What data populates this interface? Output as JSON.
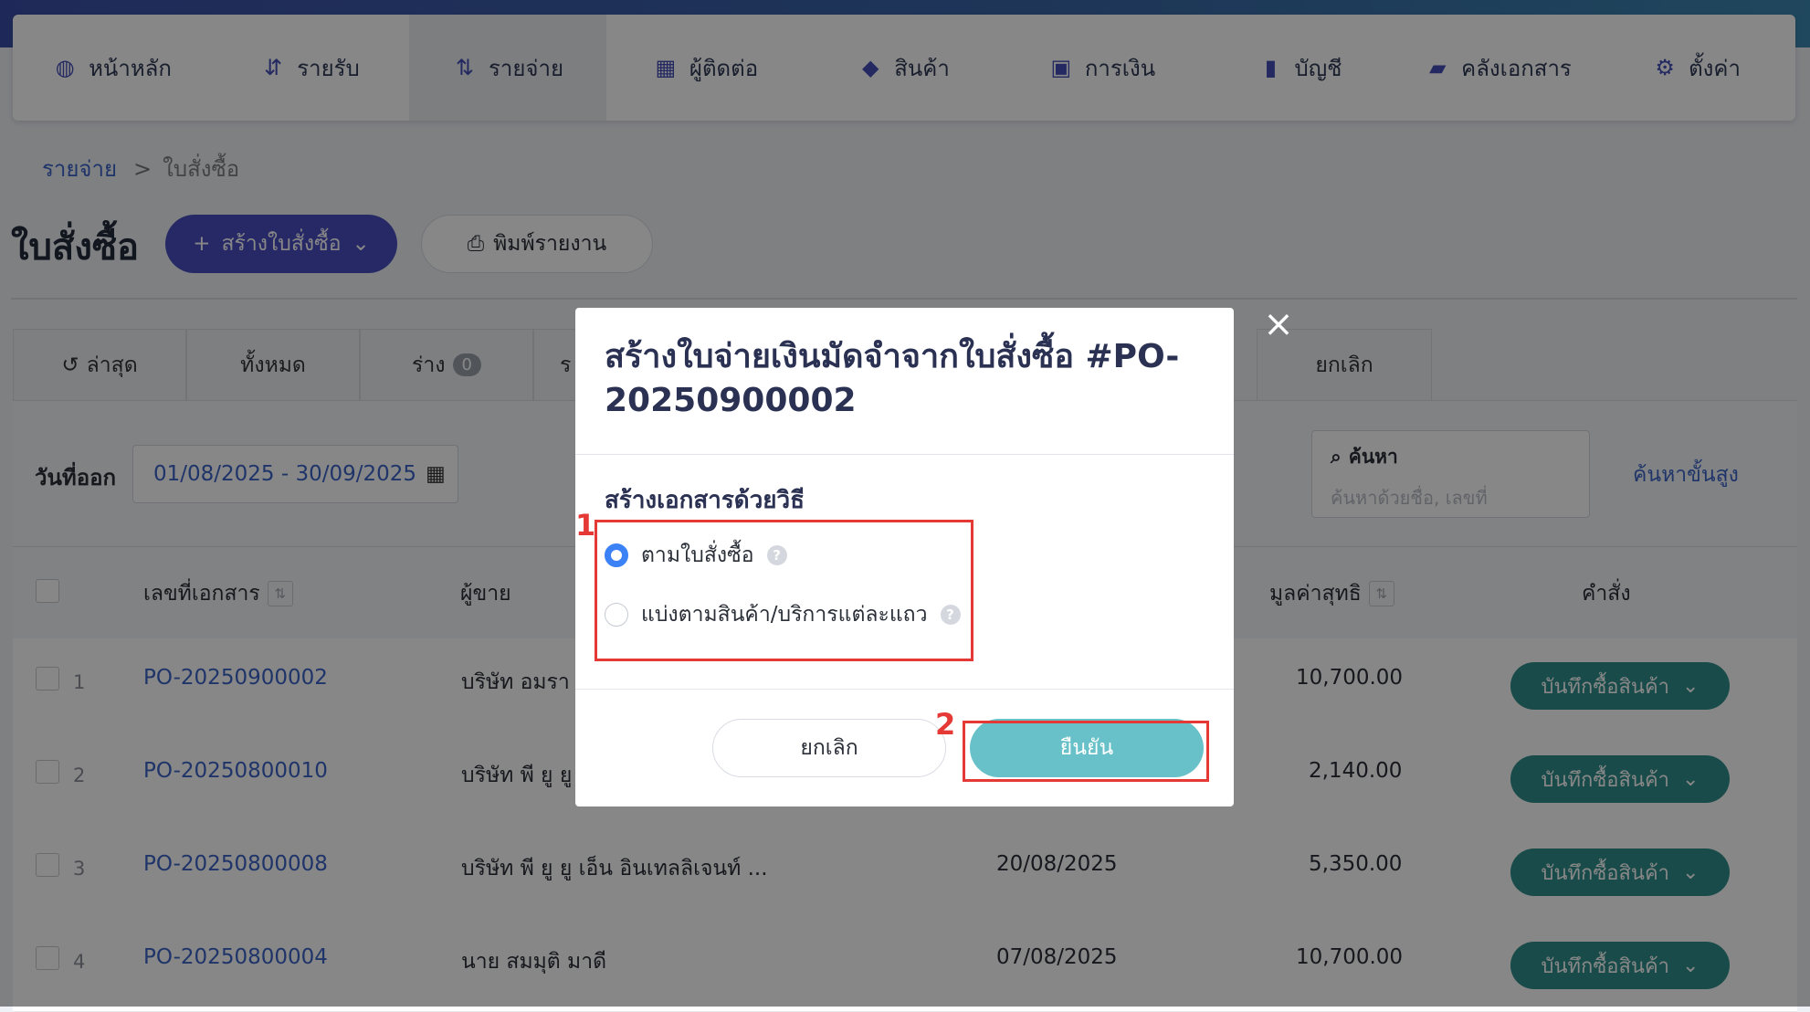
{
  "nav": {
    "items": [
      {
        "label": "หน้าหลัก",
        "icon": "dashboard-icon"
      },
      {
        "label": "รายรับ",
        "icon": "income-list-icon"
      },
      {
        "label": "รายจ่าย",
        "icon": "expense-list-icon",
        "active": true
      },
      {
        "label": "ผู้ติดต่อ",
        "icon": "contacts-icon"
      },
      {
        "label": "สินค้า",
        "icon": "product-box-icon"
      },
      {
        "label": "การเงิน",
        "icon": "money-icon"
      },
      {
        "label": "บัญชี",
        "icon": "ledger-icon"
      },
      {
        "label": "คลังเอกสาร",
        "icon": "folder-icon"
      },
      {
        "label": "ตั้งค่า",
        "icon": "gear-icon"
      }
    ]
  },
  "breadcrumb": {
    "parent": "รายจ่าย",
    "separator": ">",
    "current": "ใบสั่งซื้อ"
  },
  "page": {
    "title": "ใบสั่งซื้อ",
    "create_label": "สร้างใบสั่งซื้อ",
    "print_label": "พิมพ์รายงาน"
  },
  "tabs": {
    "latest": "ล่าสุด",
    "all": "ทั้งหมด",
    "draft": "ร่าง",
    "draft_count": "0",
    "partial": "ร",
    "cancelled": "ยกเลิก"
  },
  "filter": {
    "date_label": "วันที่ออก",
    "date_range": "01/08/2025 - 30/09/2025",
    "search_label": "ค้นหา",
    "search_placeholder": "ค้นหาด้วยชื่อ, เลขที่",
    "advanced_search": "ค้นหาขั้นสูง"
  },
  "table": {
    "headers": {
      "doc_no": "เลขที่เอกสาร",
      "vendor": "ผู้ขาย",
      "net": "มูลค่าสุทธิ",
      "actions": "คำสั่ง"
    },
    "rows": [
      {
        "num": "1",
        "doc_no": "PO-20250900002",
        "vendor": "บริษัท อมรา",
        "date": "",
        "net": "10,700.00",
        "action": "บันทึกซื้อสินค้า"
      },
      {
        "num": "2",
        "doc_no": "PO-20250800010",
        "vendor": "บริษัท พี ยู ยู",
        "date": "",
        "net": "2,140.00",
        "action": "บันทึกซื้อสินค้า"
      },
      {
        "num": "3",
        "doc_no": "PO-20250800008",
        "vendor": "บริษัท พี ยู ยู เอ็น อินเทลลิเจนท์ ...",
        "date": "20/08/2025",
        "net": "5,350.00",
        "action": "บันทึกซื้อสินค้า"
      },
      {
        "num": "4",
        "doc_no": "PO-20250800004",
        "vendor": "นาย สมมุติ มาดี",
        "date": "07/08/2025",
        "net": "10,700.00",
        "action": "บันทึกซื้อสินค้า"
      }
    ]
  },
  "modal": {
    "title": "สร้างใบจ่ายเงินมัดจำจากใบสั่งซื้อ #PO-20250900002",
    "method_label": "สร้างเอกสารด้วยวิธี",
    "options": [
      {
        "label": "ตามใบสั่งซื้อ",
        "selected": true
      },
      {
        "label": "แบ่งตามสินค้า/บริการแต่ละแถว",
        "selected": false
      }
    ],
    "cancel_label": "ยกเลิก",
    "confirm_label": "ยืนยัน"
  },
  "annotations": {
    "step1": "1",
    "step2": "2"
  },
  "colors": {
    "brand": "#4a4fc0",
    "action": "#2f8e8a",
    "confirm": "#68c1c8",
    "link": "#3b63c6",
    "highlight": "#e53935"
  }
}
